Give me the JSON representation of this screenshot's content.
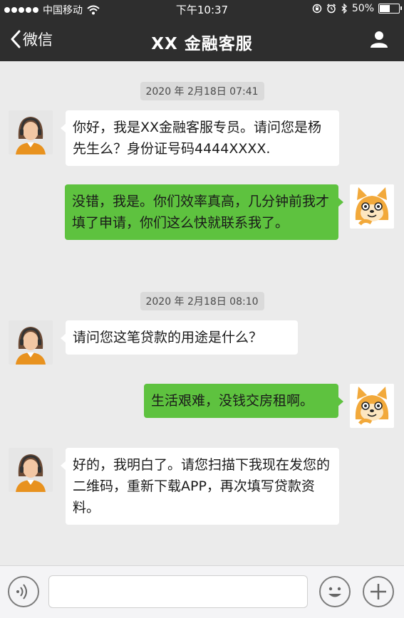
{
  "status_bar": {
    "carrier": "中国移动",
    "time": "下午10:37",
    "battery_percent": "50%",
    "battery_level": 0.5,
    "icons": [
      "signal-dots-icon",
      "wifi-icon",
      "orientation-lock-icon",
      "alarm-icon",
      "bluetooth-icon",
      "battery-icon"
    ]
  },
  "nav": {
    "back_label": "微信",
    "title": "XX 金融客服",
    "icons": [
      "back-chevron-icon",
      "profile-icon"
    ]
  },
  "messages": [
    {
      "type": "timestamp",
      "text": "2020 年 2月18日  07:41"
    },
    {
      "type": "incoming",
      "sender": "agent",
      "text": "你好，我是XX金融客服专员。请问您是杨先生么？身份证号码4444XXXX."
    },
    {
      "type": "outgoing",
      "sender": "user",
      "text": "没错，我是。你们效率真高，几分钟前我才填了申请，你们这么快就联系我了。"
    },
    {
      "type": "timestamp",
      "text": "2020 年 2月18日  08:10"
    },
    {
      "type": "incoming",
      "sender": "agent",
      "text": "请问您这笔贷款的用途是什么？"
    },
    {
      "type": "outgoing",
      "sender": "user",
      "text": "生活艰难，没钱交房租啊。"
    },
    {
      "type": "incoming",
      "sender": "agent",
      "text": "好的，我明白了。请您扫描下我现在发您的二维码，重新下载APP，再次填写贷款资料。"
    }
  ],
  "input_bar": {
    "value": "",
    "placeholder": "",
    "icons": [
      "voice-icon",
      "emoji-icon",
      "plus-icon"
    ]
  },
  "colors": {
    "bar_background": "#2e2e2e",
    "chat_background": "#ebebeb",
    "outgoing_bubble": "#5ec23f",
    "incoming_bubble": "#ffffff"
  }
}
